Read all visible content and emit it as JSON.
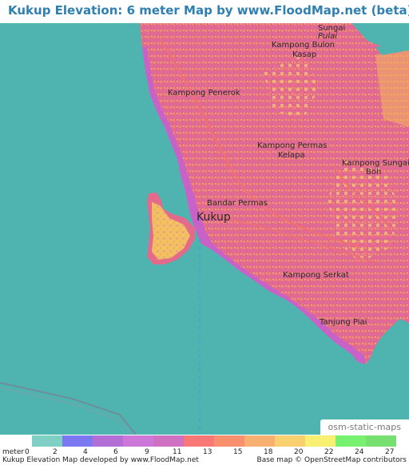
{
  "title": "Kukup Elevation: 6 meter Map by www.FloodMap.net (beta)",
  "colors": {
    "sea": "#4fb4b0",
    "land_low": "#cc66cc",
    "land_mid": "#ff6f7a",
    "land_high": "#f2a060",
    "land_higher": "#f5d86a",
    "title": "#2f7fb0"
  },
  "map": {
    "places": [
      {
        "id": "sungai-pulai",
        "text": "Sungai"
      },
      {
        "id": "pulai",
        "text": "Pulai"
      },
      {
        "id": "kampong-bulon",
        "text": "Kampong Bulon"
      },
      {
        "id": "kasap",
        "text": "Kasap"
      },
      {
        "id": "kampong-penerok",
        "text": "Kampong Penerok"
      },
      {
        "id": "kampong-permas",
        "text": "Kampong Permas"
      },
      {
        "id": "kelapa",
        "text": "Kelapa"
      },
      {
        "id": "kampong-sungai",
        "text": "Kampong Sungai"
      },
      {
        "id": "boh",
        "text": "Boh"
      },
      {
        "id": "bandar-permas",
        "text": "Bandar Permas"
      },
      {
        "id": "kukup",
        "text": "Kukup"
      },
      {
        "id": "kampong-serkat",
        "text": "Kampong Serkat"
      },
      {
        "id": "tanjung-piai",
        "text": "Tanjung Piai"
      }
    ],
    "attribution": "osm-static-maps"
  },
  "legend": {
    "unit": "meter",
    "items": [
      {
        "label": "0",
        "color": "#7ecfc4"
      },
      {
        "label": "2",
        "color": "#7b78f2"
      },
      {
        "label": "4",
        "color": "#b36fd6"
      },
      {
        "label": "6",
        "color": "#cc78d8"
      },
      {
        "label": "9",
        "color": "#d070c0"
      },
      {
        "label": "11",
        "color": "#f87878"
      },
      {
        "label": "13",
        "color": "#f89070"
      },
      {
        "label": "15",
        "color": "#f8b070"
      },
      {
        "label": "18",
        "color": "#f8d070"
      },
      {
        "label": "20",
        "color": "#f8f070"
      },
      {
        "label": "22",
        "color": "#78f070"
      },
      {
        "label": "24",
        "color": "#78e070"
      },
      {
        "label": "27",
        "color": ""
      }
    ]
  },
  "footer": {
    "left": "Kukup Elevation Map developed by www.FloodMap.net",
    "right": "Base map © OpenStreetMap contributors"
  }
}
